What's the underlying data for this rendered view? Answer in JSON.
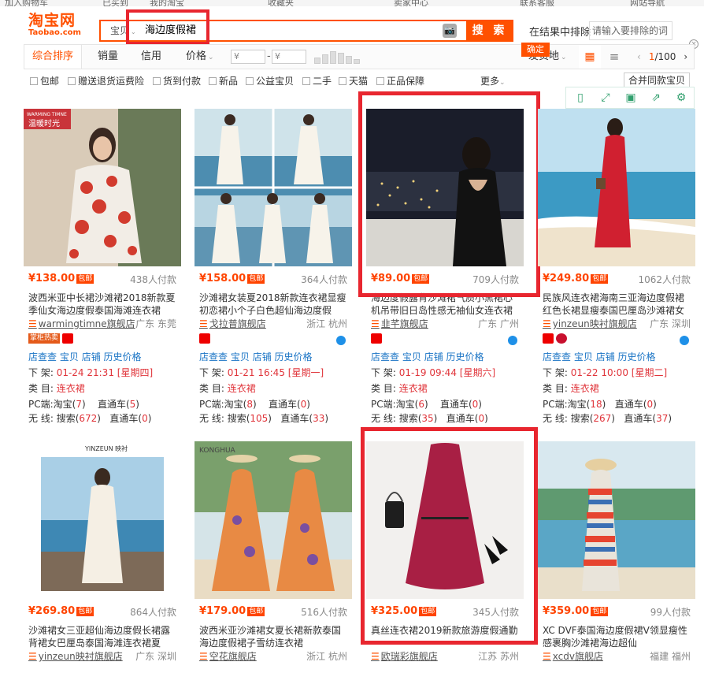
{
  "topstrip": [
    "加入购物车",
    "已买到",
    "我的淘宝",
    "收藏夹",
    "卖家中心",
    "联系客服",
    "网站导航"
  ],
  "logo": {
    "cn": "淘宝网",
    "en": "Taobao.com"
  },
  "search": {
    "category": "宝贝",
    "query": "海边度假裙",
    "button": "搜 索",
    "camera": "📷"
  },
  "exclude": {
    "label": "在结果中排除",
    "placeholder": "请输入要排除的词",
    "confirm": "确定",
    "close": "×"
  },
  "sort": {
    "items": [
      "综合排序",
      "销量",
      "信用",
      "价格"
    ],
    "price_from": "¥",
    "price_dash": "-",
    "price_to": "¥",
    "location": "发货地",
    "page_current": "1",
    "page_total": "/100",
    "prev": "‹",
    "next": "›"
  },
  "filters": [
    "包邮",
    "赠送退货运费险",
    "货到付款",
    "新品",
    "公益宝贝",
    "二手",
    "天猫",
    "正品保障"
  ],
  "more": "更多",
  "same_button": "合并同款宝贝",
  "info_labels": {
    "links": [
      "店查查",
      "宝贝",
      "店铺",
      "历史价格"
    ],
    "down": "下 架:",
    "cat": "类 目:",
    "pc": "PC端:",
    "pc_tb": "淘宝(",
    "pc_zt": "直通车(",
    "wx": "无 线:",
    "wx_ss": "搜索(",
    "wx_zt": "直通车(",
    "close": ")",
    "cat_val": "连衣裙"
  },
  "products": [
    {
      "price": "¥138.00",
      "tag": "包邮",
      "sales": "438人付款",
      "title_pre": "波西米亚中长裙沙滩裙2018新款夏季仙女海边度假泰国海滩连衣裙",
      "shop": "warmingtimne旗舰店",
      "loc": "广东 东莞",
      "badge": "掌柜热卖",
      "down": "01-24 21:31",
      "week": "[星期四]",
      "pc_tb": "7",
      "pc_zt": "5",
      "wx_ss": "672",
      "wx_zt": "0"
    },
    {
      "price": "¥158.00",
      "tag": "包邮",
      "sales": "364人付款",
      "title_pre": "沙滩裙女装夏2018新款连衣裙显瘦初恋裙小个子白色超仙海边度假",
      "shop": "戈拉普旗舰店",
      "loc": "浙江 杭州",
      "badge": "",
      "down": "01-21 16:45",
      "week": "[星期一]",
      "pc_tb": "8",
      "pc_zt": "0",
      "wx_ss": "105",
      "wx_zt": "33"
    },
    {
      "price": "¥89.00",
      "tag": "包邮",
      "sales": "709人付款",
      "title_pre": "海边度假露背沙滩裙气质小黑裙心机吊带旧日岛性感无袖仙女连衣裙",
      "shop": "韭芊旗舰店",
      "loc": "广东 广州",
      "badge": "",
      "down": "01-19 09:44",
      "week": "[星期六]",
      "pc_tb": "6",
      "pc_zt": "0",
      "wx_ss": "35",
      "wx_zt": "0"
    },
    {
      "price": "¥249.80",
      "tag": "包邮",
      "sales": "1062人付款",
      "title_pre": "民族风连衣裙海南三亚海边度假裙红色长裙显瘦泰国巴厘岛沙滩裙女",
      "shop": "yinzeun映衬旗舰店",
      "loc": "广东 深圳",
      "badge": "",
      "down": "01-22 10:00",
      "week": "[星期二]",
      "pc_tb": "18",
      "pc_zt": "0",
      "wx_ss": "267",
      "wx_zt": "37"
    },
    {
      "price": "¥269.80",
      "tag": "包邮",
      "sales": "864人付款",
      "title_pre": "沙滩裙女三亚超仙海边度假长裙露背裙女巴厘岛泰国海滩连衣裙夏",
      "shop": "yinzeun映衬旗舰店",
      "loc": "广东 深圳"
    },
    {
      "price": "¥179.00",
      "tag": "包邮",
      "sales": "516人付款",
      "title_pre": "波西米亚沙滩裙女夏长裙新款泰国海边度假裙子雪纺连衣裙",
      "shop": "空花旗舰店",
      "loc": "浙江 杭州"
    },
    {
      "price": "¥325.00",
      "tag": "包邮",
      "sales": "345人付款",
      "title_pre": "真丝连衣裙2019新款旅游度假通勤",
      "shop": "欧瑞彩旗舰店",
      "loc": "江苏 苏州"
    },
    {
      "price": "¥359.00",
      "tag": "包邮",
      "sales": "99人付款",
      "title_pre": "XC DVF泰国海边度假裙V领显瘦性感裹胸沙滩裙海边超仙",
      "shop": "xcdv旗舰店",
      "loc": "福建 福州"
    }
  ],
  "image_texts": {
    "p1_banner": "WARMING TIMNE",
    "p1_banner_cn": "温暖时光",
    "p5_brand": "YINZEUN 映衬",
    "p6_brand": "KONGHUA"
  },
  "colors": {
    "accent": "#ff5000",
    "price": "#ff4400",
    "link": "#1a74c5",
    "highlight_frame": "#e8262f"
  }
}
